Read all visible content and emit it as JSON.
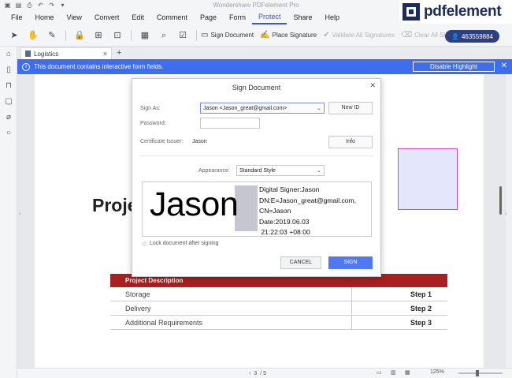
{
  "app": {
    "title": "Wondershare PDFelement Pro",
    "brand": "pdfelement"
  },
  "menu": [
    "File",
    "Home",
    "View",
    "Convert",
    "Edit",
    "Comment",
    "Page",
    "Form",
    "Protect",
    "Share",
    "Help"
  ],
  "menu_active": "Protect",
  "toolbar": {
    "sign_document": "Sign Document",
    "place_signature": "Place Signature",
    "validate_all": "Validate All Signatures",
    "clear_all": "Clear All Signatures",
    "user_id": "463559884"
  },
  "tab": {
    "name": "Logistics"
  },
  "banner": {
    "message": "This document contains interactive form fields.",
    "button": "Disable Highlight"
  },
  "document": {
    "heading": "Proje",
    "table": {
      "header": "Project Description",
      "rows": [
        {
          "name": "Storage",
          "step": "Step 1"
        },
        {
          "name": "Delivery",
          "step": "Step 2"
        },
        {
          "name": "Additional Requirements",
          "step": "Step 3"
        }
      ]
    }
  },
  "dialog": {
    "title": "Sign Document",
    "sign_as_label": "Sign As:",
    "sign_as_value": "Jason <Jason_great@gmail.com>",
    "new_id": "New ID",
    "password_label": "Password:",
    "password_value": "",
    "issuer_label": "Certificate Issuer:",
    "issuer_value": "Jason",
    "info": "Info",
    "appearance_label": "Appearance:",
    "appearance_value": "Standard Style",
    "preview_name": "Jason",
    "preview_info": "Digital Signer:Jason\nDN:E=Jason_great@gmail.com,\nCN=Jason\nDate:2019.06.03\n 21:22:03 +08:00",
    "lock_label": "Lock document after signing",
    "cancel": "CANCEL",
    "sign": "SIGN"
  },
  "status": {
    "page": "3",
    "page_total": "/ 5",
    "zoom": "125%"
  },
  "colors": {
    "accent": "#3e6df0",
    "table_header": "#a8201f",
    "user_pill": "#2d3f7e",
    "sign_button": "#4f78f2"
  }
}
